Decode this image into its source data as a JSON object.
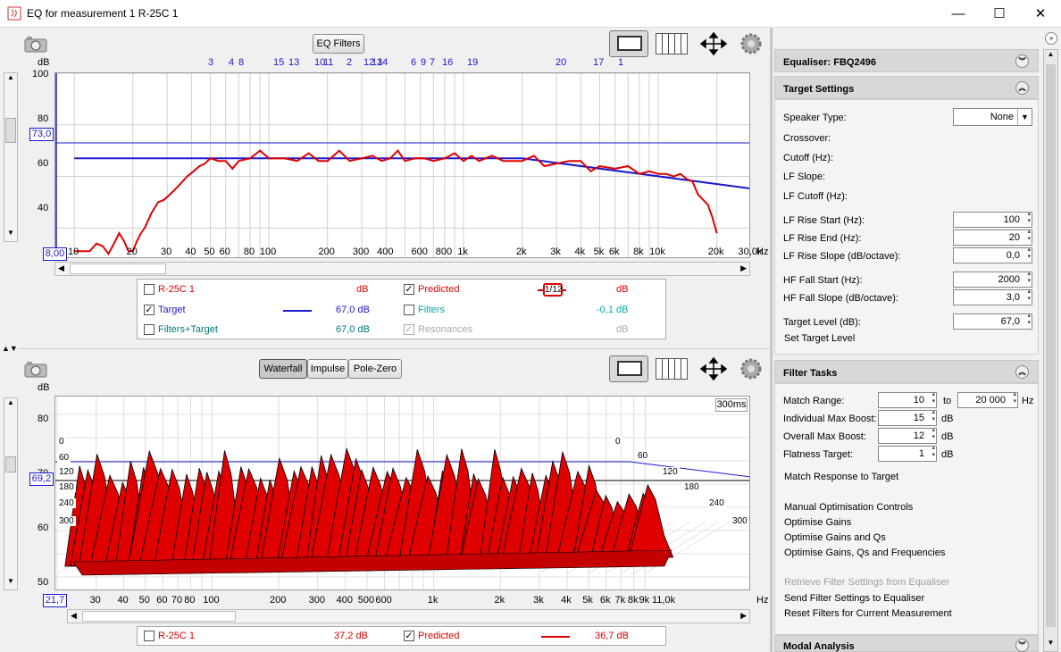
{
  "window": {
    "title": "EQ for measurement 1 R-25C 1"
  },
  "top_plot": {
    "eq_filters_label": "EQ Filters",
    "y_unit": "dB",
    "y_ticks": [
      "100",
      "80",
      "60",
      "40"
    ],
    "x_ticks": [
      "10",
      "20",
      "30",
      "40",
      "50",
      "60",
      "80",
      "100",
      "200",
      "300",
      "400",
      "600",
      "800",
      "1k",
      "2k",
      "3k",
      "4k",
      "5k",
      "6k",
      "8k",
      "10k",
      "20k",
      "30,0k",
      "Hz"
    ],
    "filter_numbers_row1": [
      "3",
      "4",
      "8",
      "15",
      "13",
      "10",
      "11",
      "2",
      "12",
      "13",
      "14",
      "6",
      "9",
      "7",
      "16",
      "19",
      "20",
      "17",
      "1"
    ],
    "filter_numbers_row2": [
      "18"
    ],
    "cursor_y_label": "73,0",
    "cursor_x_label": "8,00",
    "legend": {
      "r25c": {
        "label": "R-25C 1",
        "value": "dB",
        "checked": false
      },
      "predicted": {
        "label": "Predicted",
        "value": "dB",
        "checked": true,
        "smoothing": "1/12"
      },
      "target": {
        "label": "Target",
        "value": "67,0 dB",
        "checked": true
      },
      "filters": {
        "label": "Filters",
        "value": "-0,1 dB",
        "checked": false
      },
      "filters_target": {
        "label": "Filters+Target",
        "value": "67,0 dB",
        "checked": false
      },
      "resonances": {
        "label": "Resonances",
        "value": "dB",
        "checked": true
      }
    }
  },
  "bottom_plot": {
    "tabs": [
      "Waterfall",
      "Impulse",
      "Pole-Zero"
    ],
    "active_tab": "Waterfall",
    "y_unit": "dB",
    "y_ticks": [
      "80",
      "70",
      "60",
      "50"
    ],
    "x_ticks": [
      "30",
      "40",
      "50",
      "60",
      "70",
      "80",
      "100",
      "200",
      "300",
      "400",
      "500",
      "600",
      "1k",
      "2k",
      "3k",
      "4k",
      "5k",
      "6k",
      "7k",
      "8k",
      "9k",
      "11,0k",
      "Hz"
    ],
    "time_label": "300ms",
    "time_left": [
      "0",
      "60",
      "120",
      "180",
      "240",
      "300"
    ],
    "time_right": [
      "0",
      "60",
      "120",
      "180",
      "240",
      "300"
    ],
    "cursor_y_label": "69,2",
    "cursor_x_label": "21,7",
    "legend": {
      "r25c": {
        "label": "R-25C 1",
        "value": "37,2 dB",
        "checked": false
      },
      "predicted": {
        "label": "Predicted",
        "value": "36,7 dB",
        "checked": true
      }
    }
  },
  "right_panel": {
    "equaliser_title": "Equaliser: FBQ2496",
    "target_settings": {
      "title": "Target Settings",
      "speaker_type_label": "Speaker Type:",
      "speaker_type_value": "None",
      "crossover_label": "Crossover:",
      "cutoff_label": "Cutoff (Hz):",
      "lf_slope_label": "LF Slope:",
      "lf_cutoff_label": "LF Cutoff (Hz):",
      "lf_rise_start_label": "LF Rise Start (Hz):",
      "lf_rise_start_value": "100",
      "lf_rise_end_label": "LF Rise End (Hz):",
      "lf_rise_end_value": "20",
      "lf_rise_slope_label": "LF Rise Slope (dB/octave):",
      "lf_rise_slope_value": "0,0",
      "hf_fall_start_label": "HF Fall Start (Hz):",
      "hf_fall_start_value": "2000",
      "hf_fall_slope_label": "HF Fall Slope (dB/octave):",
      "hf_fall_slope_value": "3,0",
      "target_level_label": "Target Level (dB):",
      "target_level_value": "67,0",
      "set_target_level": "Set Target Level"
    },
    "filter_tasks": {
      "title": "Filter Tasks",
      "match_range_label": "Match Range:",
      "match_range_from": "10",
      "to_label": "to",
      "match_range_to": "20 000",
      "hz_label": "Hz",
      "ind_max_boost_label": "Individual Max Boost:",
      "ind_max_boost_value": "15",
      "overall_max_boost_label": "Overall Max Boost:",
      "overall_max_boost_value": "12",
      "flatness_label": "Flatness Target:",
      "flatness_value": "1",
      "db_label": "dB",
      "match_response": "Match Response to Target",
      "manual_controls": "Manual Optimisation Controls",
      "optimise_gains": "Optimise Gains",
      "optimise_gains_qs": "Optimise Gains and Qs",
      "optimise_all": "Optimise Gains, Qs and Frequencies",
      "retrieve": "Retrieve Filter Settings from Equaliser",
      "send": "Send Filter Settings to Equaliser",
      "reset": "Reset Filters for Current Measurement"
    },
    "modal_title": "Modal Analysis"
  },
  "chart_data": [
    {
      "type": "line",
      "xscale": "log",
      "xlim": [
        8,
        30000
      ],
      "ylim": [
        28,
        100
      ],
      "ylabel": "dB",
      "series": [
        {
          "name": "Target",
          "color": "#1a1ad0",
          "x": [
            10,
            2000,
            30000
          ],
          "y": [
            67,
            67,
            55.3
          ]
        },
        {
          "name": "Predicted",
          "color": "#e00000",
          "x": [
            10,
            12,
            13,
            14,
            15,
            16,
            17,
            18,
            19,
            20,
            21,
            22,
            23,
            25,
            27,
            29,
            32,
            35,
            38,
            41,
            44,
            47,
            50,
            55,
            60,
            65,
            70,
            80,
            90,
            100,
            120,
            140,
            160,
            180,
            200,
            230,
            260,
            300,
            340,
            380,
            420,
            460,
            500,
            560,
            630,
            700,
            800,
            900,
            1000,
            1100,
            1200,
            1400,
            1600,
            1800,
            2000,
            2300,
            2600,
            3000,
            3500,
            4000,
            4500,
            5000,
            6000,
            7000,
            8000,
            9000,
            10000,
            11000,
            12000,
            13000,
            14000,
            15000,
            16000,
            17000,
            18000,
            19000,
            20000
          ],
          "y": [
            31,
            31,
            34,
            33,
            30,
            34,
            38,
            35,
            31,
            31,
            35,
            38,
            40,
            46,
            50,
            51,
            54,
            57,
            60,
            62,
            64,
            65,
            67,
            66,
            66,
            63,
            66,
            67,
            70,
            67,
            67,
            66,
            69,
            66,
            66,
            70,
            66,
            67,
            68,
            66,
            67,
            70,
            66,
            67,
            67,
            66,
            67,
            69,
            66,
            68,
            66,
            68,
            66,
            66,
            66,
            68,
            64,
            65,
            66,
            66,
            62,
            64,
            63,
            64,
            61,
            62,
            61,
            61,
            60,
            61,
            59,
            58,
            53,
            51,
            49,
            44,
            38
          ]
        }
      ]
    },
    {
      "type": "area",
      "xscale": "log",
      "xlim": [
        20,
        11000
      ],
      "ylim": [
        50,
        85
      ],
      "ylabel": "dB",
      "title": "300ms",
      "series": [
        {
          "name": "Predicted",
          "color": "#e00000"
        }
      ]
    }
  ]
}
